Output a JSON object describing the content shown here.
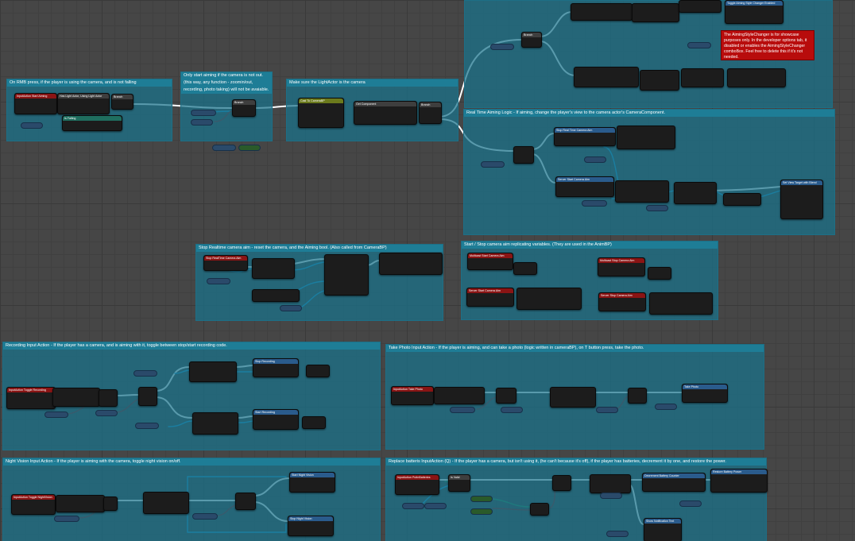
{
  "comments": {
    "rmb": "On RMB press, if the player is using the camera, and is not falling",
    "only_aiming": "Only start aiming if the camera is not out. (this way, any function - zoomin/out, recording, photo taking) will not be avaiable.",
    "light_actor": "Make sure the LightActor is the camera",
    "realtime": "Real Time Aiming Logic - If aiming, change the player's view to the camera actor's CameraComponent.",
    "stop_realtime": "Stop Realtime camera aim - reset the camera, and the Aiming bool. (Also called from CameraBP)",
    "start_stop": "Start / Stop camera aim replicating variables. (They are used in the AnimBP)",
    "recording": "Recording Input Action - If the player has a camera, and is aiming with it, toggle between stop/start recording code.",
    "take_photo": "Take Photo Input Action - If the player is aiming, and can take a photo (logic written in cameraBP), on T button press, take the photo.",
    "night_vision": "Night Vision Input Action - If the player is aiming with the camera, toggle night vision on/off.",
    "batteries": "Replace batteris InputAction (Q) - If the player has a camera, but isn't using it, (he can't because it's off), if the player has batteries, decrement it by one, and restore the power."
  },
  "warning": "The AimingStyleChanger is for showcase purposes only. In the developer options tab, it disabled or enables the AimingStyleChanger comboBox. Feel free to delete this if it's not needed.",
  "nodes": {
    "n1": "InputAction Start Aiming",
    "n2": "Has Light Actor, Using Light Actor",
    "n3": "Branch",
    "n4": "Is Falling",
    "n5": "Branch",
    "n6": "Cast To CameraBP",
    "n7": "Get Component",
    "n8": "Branch",
    "n9": "Branch",
    "n10": "Toggle Aiming Style Changer Enabled",
    "n11": "Stop Real Time Camera Aim",
    "n12": "Server Start Camera Aim",
    "n13": "Set View Target with Blend",
    "n14": "Stop RealTime Camera Aim",
    "n15": "Multicast Start Camera Aim",
    "n16": "Server Start Camera Aim",
    "n17": "Multicast Stop Camera Aim",
    "n18": "Server Stop Camera Aim",
    "n19": "InputAction Toggle Recording",
    "n20": "Stop Recording",
    "n21": "Start Recording",
    "n22": "InputAction Take Photo",
    "n23": "Take Photo",
    "n24": "InputAction Toggle NightVision",
    "n25": "Start Night Vision",
    "n26": "Stop Night Vision",
    "n27": "InputAction PutInBatteries",
    "n28": "Is Valid",
    "n29": "Decrement Battery Counter",
    "n30": "Restore Battery Power",
    "n31": "Show Notification Text"
  },
  "colors": {
    "exec": "#ffffff",
    "object": "#1e9ad6",
    "bool": "#8b1a1a",
    "struct": "#2e8b57"
  }
}
